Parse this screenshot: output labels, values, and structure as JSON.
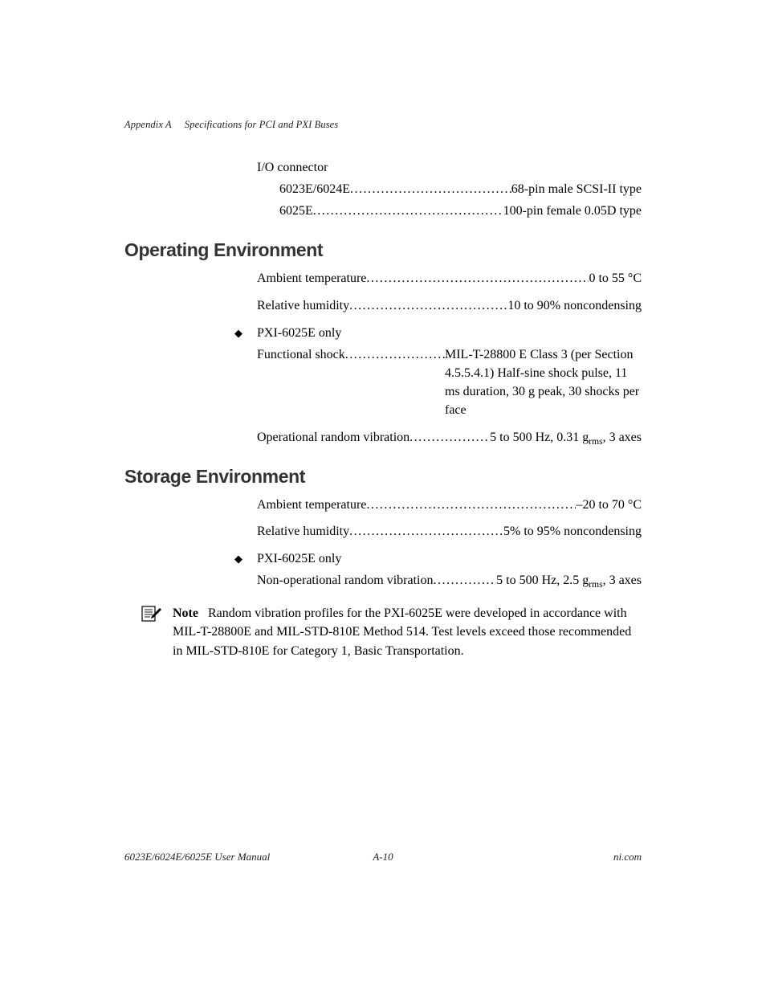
{
  "header": {
    "appendix": "Appendix A",
    "title": "Specifications for PCI and PXI Buses"
  },
  "io_connector": {
    "heading": "I/O connector",
    "items": [
      {
        "label": "6023E/6024E",
        "value": "68-pin male SCSI-II type"
      },
      {
        "label": "6025E",
        "value": "100-pin female 0.05D type"
      }
    ]
  },
  "operating": {
    "heading": "Operating Environment",
    "rows": [
      {
        "label": "Ambient temperature",
        "value": "0 to 55 °C"
      },
      {
        "label": "Relative humidity",
        "value": "10 to 90% noncondensing"
      }
    ],
    "pxi_label": "PXI-6025E only",
    "pxi_rows": [
      {
        "label": "Functional shock",
        "value_html": "MIL-T-28800 E Class 3 (per Section 4.5.5.4.1) Half-sine shock pulse, 11 ms duration, 30 g peak, 30 shocks per face",
        "multi": true
      },
      {
        "label": "Operational random vibration",
        "value_html": "5 to 500 Hz, 0.31 g<sub>rms</sub>, 3 axes"
      }
    ]
  },
  "storage": {
    "heading": "Storage Environment",
    "rows": [
      {
        "label": "Ambient temperature",
        "value": "–20 to 70 °C"
      },
      {
        "label": "Relative humidity",
        "value": "5% to 95% noncondensing"
      }
    ],
    "pxi_label": "PXI-6025E only",
    "pxi_rows": [
      {
        "label": "Non-operational random vibration",
        "value_html": "5 to 500 Hz, 2.5 g<sub>rms</sub>, 3 axes"
      }
    ]
  },
  "note": {
    "label": "Note",
    "text": "Random vibration profiles for the PXI-6025E were developed in accordance with MIL-T-28800E and MIL-STD-810E Method 514. Test levels exceed those recommended in MIL-STD-810E for Category 1, Basic Transportation."
  },
  "footer": {
    "left": "6023E/6024E/6025E User Manual",
    "center": "A-10",
    "right": "ni.com"
  },
  "dots": "..............................................................."
}
